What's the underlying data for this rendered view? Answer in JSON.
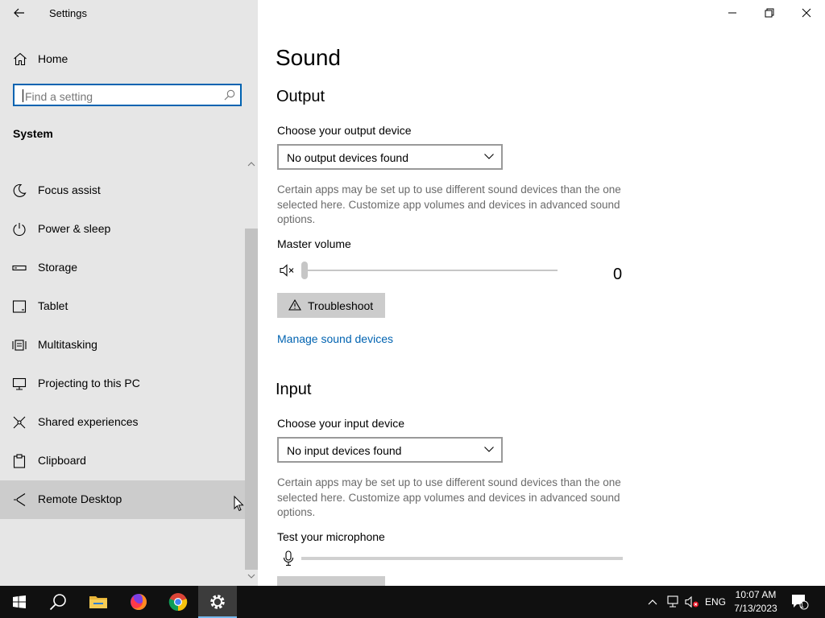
{
  "window": {
    "title": "Settings"
  },
  "sidebar": {
    "home_label": "Home",
    "search_placeholder": "Find a setting",
    "section_title": "System",
    "items": [
      {
        "label": "Focus assist",
        "icon": "moon-icon"
      },
      {
        "label": "Power & sleep",
        "icon": "power-icon"
      },
      {
        "label": "Storage",
        "icon": "storage-icon"
      },
      {
        "label": "Tablet",
        "icon": "tablet-icon"
      },
      {
        "label": "Multitasking",
        "icon": "multitasking-icon"
      },
      {
        "label": "Projecting to this PC",
        "icon": "projecting-icon"
      },
      {
        "label": "Shared experiences",
        "icon": "shared-experiences-icon"
      },
      {
        "label": "Clipboard",
        "icon": "clipboard-icon"
      },
      {
        "label": "Remote Desktop",
        "icon": "remote-desktop-icon"
      }
    ],
    "selected_index": 8
  },
  "main": {
    "title": "Sound",
    "output": {
      "heading": "Output",
      "device_label": "Choose your output device",
      "device_value": "No output devices found",
      "description": "Certain apps may be set up to use different sound devices than the one selected here. Customize app volumes and devices in advanced sound options.",
      "volume_label": "Master volume",
      "volume_value": "0",
      "troubleshoot_label": "Troubleshoot",
      "manage_link": "Manage sound devices"
    },
    "input": {
      "heading": "Input",
      "device_label": "Choose your input device",
      "device_value": "No input devices found",
      "description": "Certain apps may be set up to use different sound devices than the one selected here. Customize app volumes and devices in advanced sound options.",
      "mic_label": "Test your microphone"
    }
  },
  "taskbar": {
    "apps": [
      "windows-start-icon",
      "search-icon",
      "file-explorer-icon",
      "firefox-icon",
      "chrome-icon",
      "settings-icon"
    ],
    "active_app": "settings-icon",
    "language": "ENG",
    "time": "10:07 AM",
    "date": "7/13/2023",
    "notification_count": "1"
  },
  "colors": {
    "accent": "#0063b1",
    "sidebar_bg": "#e6e6e6",
    "taskbar_bg": "#101010"
  }
}
